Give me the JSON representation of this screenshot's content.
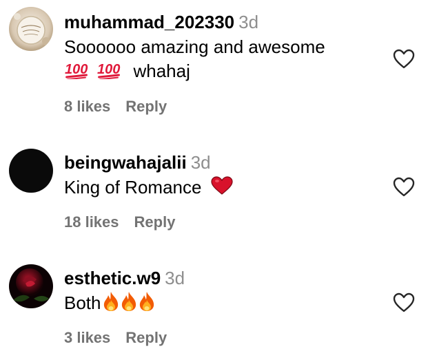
{
  "comments": [
    {
      "username": "muhammad_202330",
      "time": "3d",
      "line1": "Soooooo amazing and awesome",
      "line2_emojis": [
        "hundred-points",
        "hundred-points"
      ],
      "line2_text": "whahaj",
      "likes": "8 likes",
      "reply": "Reply"
    },
    {
      "username": "beingwahajalii",
      "time": "3d",
      "line1": "King of Romance",
      "line1_emoji": "red-heart",
      "likes": "18 likes",
      "reply": "Reply"
    },
    {
      "username": "esthetic.w9",
      "time": "3d",
      "line1": "Both",
      "line1_emojis": [
        "fire",
        "fire",
        "fire"
      ],
      "likes": "3 likes",
      "reply": "Reply"
    }
  ],
  "icons": {
    "like": "heart-outline-icon",
    "avatar1": "avatar-cake-image",
    "avatar2": "avatar-dark-image",
    "avatar3": "avatar-rose-image"
  },
  "colors": {
    "username": "#000000",
    "secondary": "#737373",
    "timestamp": "#8e8e8e",
    "heart_outline": "#262626"
  }
}
